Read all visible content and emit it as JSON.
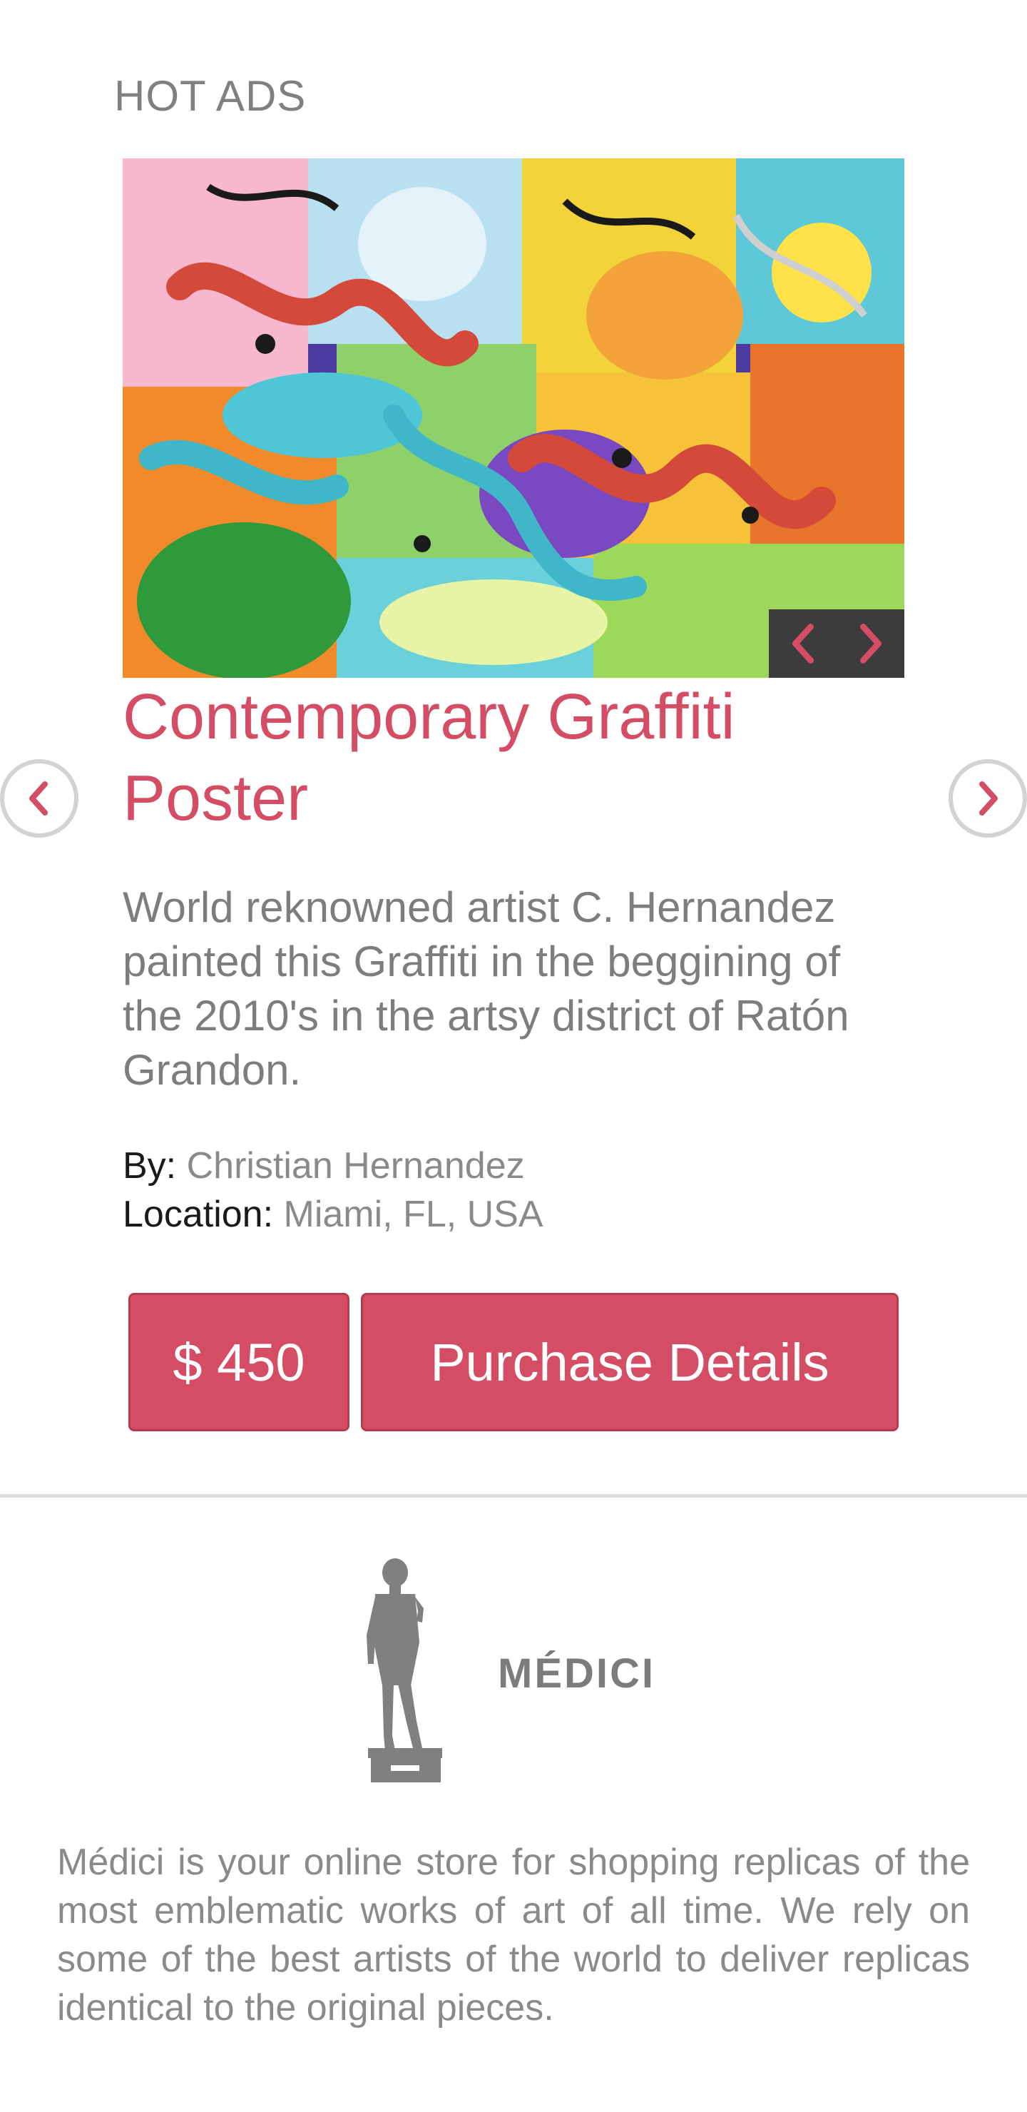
{
  "section": {
    "title": "HOT ADS"
  },
  "ad": {
    "title": "Contemporary Graffiti Poster",
    "description": "World reknowned artist C. Hernandez painted this Graffiti in the beggining of the 2010's in the artsy district of Ratón Grandon.",
    "by_label": "By:",
    "by_value": "Christian Hernandez",
    "location_label": "Location:",
    "location_value": "Miami, FL, USA",
    "price_label": "$ 450",
    "purchase_label": "Purchase Details"
  },
  "icons": {
    "image_prev": "chevron-left-icon",
    "image_next": "chevron-right-icon",
    "carousel_prev": "chevron-left-icon",
    "carousel_next": "chevron-right-icon",
    "logo": "statue-icon"
  },
  "colors": {
    "accent": "#d44d64",
    "nav_bg": "#3c3c3c",
    "text_gray": "#7d7d7d"
  },
  "footer": {
    "brand": "MÉDICI",
    "text": "Médici is your online store for shopping replicas of the most emblematic works of art of all time. We rely on some of the best artists of the world to deliver replicas identical to the original pieces."
  }
}
